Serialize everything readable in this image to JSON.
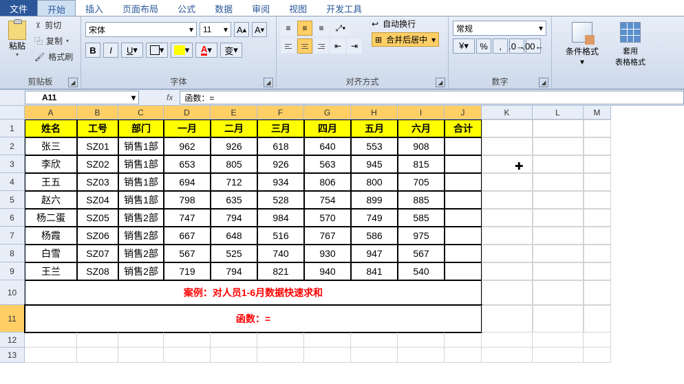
{
  "tabs": {
    "file": "文件",
    "home": "开始",
    "insert": "插入",
    "layout": "页面布局",
    "formula": "公式",
    "data": "数据",
    "review": "审阅",
    "view": "视图",
    "dev": "开发工具"
  },
  "clipboard": {
    "paste": "粘贴",
    "cut": "剪切",
    "copy": "复制",
    "fmt": "格式刷",
    "group": "剪贴板"
  },
  "font": {
    "name": "宋体",
    "size": "11",
    "bold": "B",
    "italic": "I",
    "underline": "U",
    "group": "字体",
    "charA": "A",
    "wen": "变"
  },
  "align": {
    "wrap": "自动换行",
    "merge": "合并后居中",
    "group": "对齐方式"
  },
  "number": {
    "general": "常规",
    "group": "数字"
  },
  "styles": {
    "cond": "条件格式",
    "tablefmt": "套用\n表格格式"
  },
  "namebox": "A11",
  "formula": "函数：=",
  "cols": [
    "A",
    "B",
    "C",
    "D",
    "E",
    "F",
    "G",
    "H",
    "I",
    "J",
    "K",
    "L",
    "M"
  ],
  "headers": [
    "姓名",
    "工号",
    "部门",
    "一月",
    "二月",
    "三月",
    "四月",
    "五月",
    "六月",
    "合计"
  ],
  "rows": [
    [
      "张三",
      "SZ01",
      "销售1部",
      "962",
      "926",
      "618",
      "640",
      "553",
      "908",
      ""
    ],
    [
      "李欣",
      "SZ02",
      "销售1部",
      "653",
      "805",
      "926",
      "563",
      "945",
      "815",
      ""
    ],
    [
      "王五",
      "SZ03",
      "销售1部",
      "694",
      "712",
      "934",
      "806",
      "800",
      "705",
      ""
    ],
    [
      "赵六",
      "SZ04",
      "销售1部",
      "798",
      "635",
      "528",
      "754",
      "899",
      "885",
      ""
    ],
    [
      "杨二蛋",
      "SZ05",
      "销售2部",
      "747",
      "794",
      "984",
      "570",
      "749",
      "585",
      ""
    ],
    [
      "杨霞",
      "SZ06",
      "销售2部",
      "667",
      "648",
      "516",
      "767",
      "586",
      "975",
      ""
    ],
    [
      "白雪",
      "SZ07",
      "销售2部",
      "567",
      "525",
      "740",
      "930",
      "947",
      "567",
      ""
    ],
    [
      "王兰",
      "SZ08",
      "销售2部",
      "719",
      "794",
      "821",
      "940",
      "841",
      "540",
      ""
    ]
  ],
  "note1": "案例：对人员1-6月数据快速求和",
  "note2": "函数：="
}
